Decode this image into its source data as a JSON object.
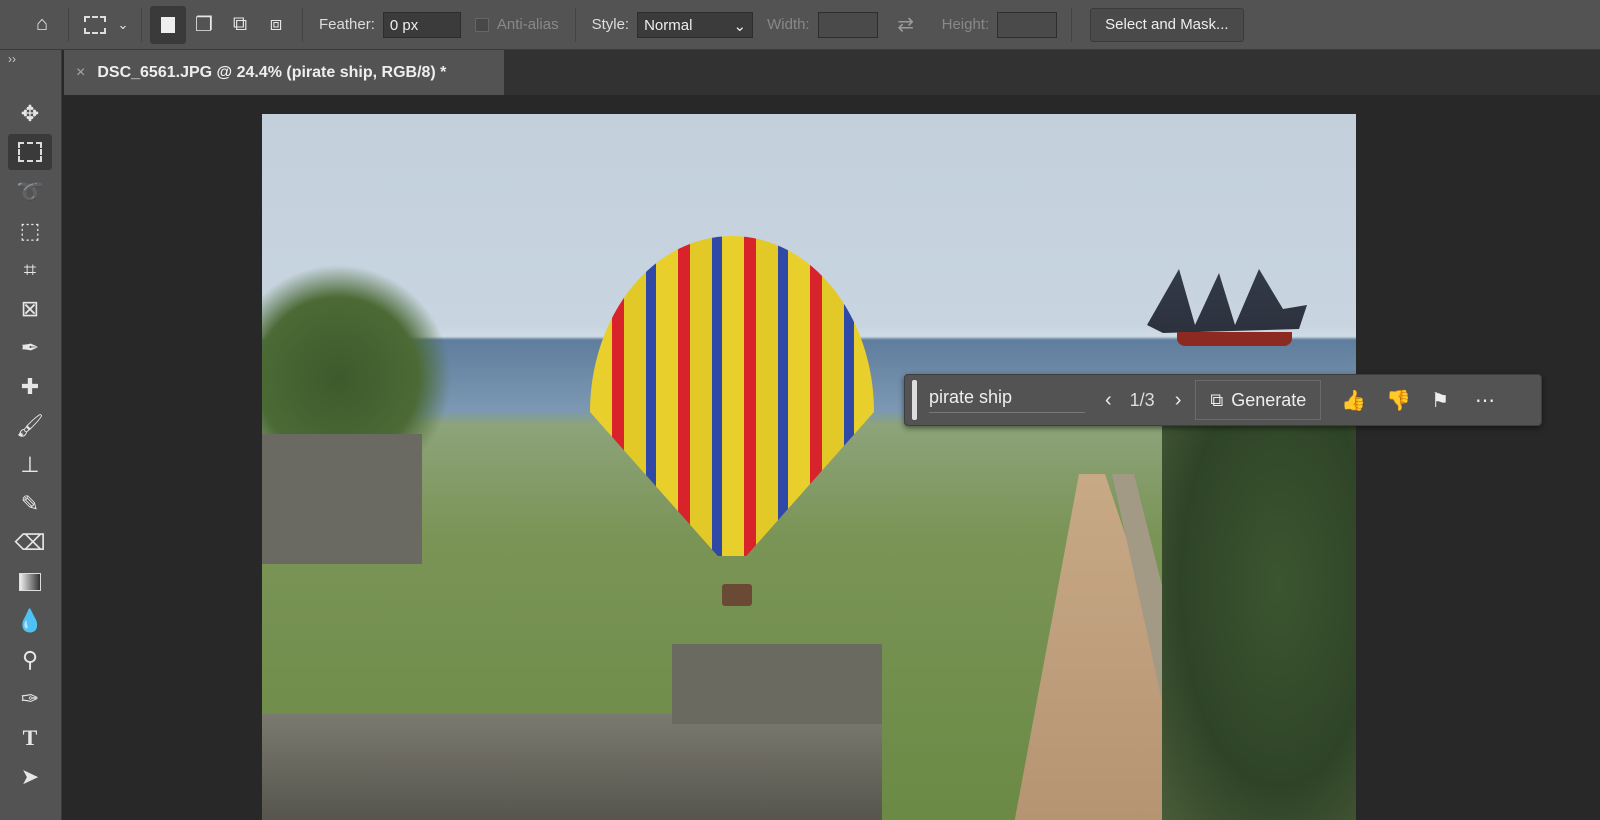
{
  "options_bar": {
    "feather_label": "Feather:",
    "feather_value": "0 px",
    "antialias_label": "Anti-alias",
    "style_label": "Style:",
    "style_value": "Normal",
    "width_label": "Width:",
    "height_label": "Height:",
    "select_mask_label": "Select and Mask..."
  },
  "document": {
    "tab_title": "DSC_6561.JPG @ 24.4% (pirate ship, RGB/8) *",
    "close": "×"
  },
  "tools": [
    "move",
    "rectangular-marquee",
    "lasso",
    "object-selection",
    "crop",
    "frame",
    "eyedropper",
    "spot-healing",
    "brush",
    "clone-stamp",
    "history-brush",
    "eraser",
    "gradient",
    "blur",
    "dodge",
    "pen",
    "type",
    "path-selection"
  ],
  "contextual_taskbar": {
    "prompt": "pirate ship",
    "variation": "1/3",
    "generate_label": "Generate"
  },
  "colors": {
    "panel": "#535353",
    "canvas_bg": "#282828"
  }
}
